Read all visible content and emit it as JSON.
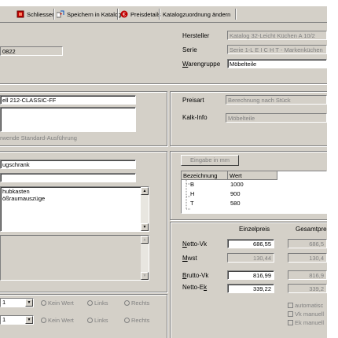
{
  "toolbar": {
    "close_label": "Schliessen",
    "save_catalog_label": "Speichern in Katalog",
    "price_details_label": "Preisdetails",
    "catalog_assign_label": "Katalogzuordnung ändern"
  },
  "header": {
    "article_no": "0822",
    "hersteller_label": "Hersteller",
    "hersteller_value": "Katalog 32-Leicht Küchen A 10/2",
    "serie_label": "Serie",
    "serie_value": "Serie 1-L E I C H T - Markenküchen",
    "warengruppe_label": "Warengruppe",
    "warengruppe_value": "Möbelteile"
  },
  "model": {
    "model_value": "ell 212-CLASSIC-FF",
    "standard_label": "rwende Standard-Ausführung"
  },
  "preis": {
    "preisart_label": "Preisart",
    "preisart_value": "Berechnung nach Stück",
    "kalk_label": "Kalk-Info",
    "kalk_value": "Möbelteile"
  },
  "article": {
    "name_value": "ugschrank",
    "desc_lines": [
      "hubkasten",
      "ößraumauszüge"
    ]
  },
  "dimensions": {
    "input_button": "Eingabe in mm",
    "columns": [
      "Bezeichnung",
      "Wert"
    ],
    "rows": [
      {
        "name": "B",
        "value": "1000"
      },
      {
        "name": "H",
        "value": "900"
      },
      {
        "name": "T",
        "value": "580"
      }
    ]
  },
  "prices": {
    "col_unit": "Einzelpreis",
    "col_total": "Gesamtpre",
    "rows": [
      {
        "label": "Netto-Vk",
        "unit": "686,55",
        "total": "686,5"
      },
      {
        "label": "Mwst",
        "unit": "130,44",
        "total": "130,4"
      },
      {
        "label": "Brutto-Vk",
        "unit": "816,99",
        "total": "816,9"
      },
      {
        "label": "Netto-Ek",
        "unit": "339,22",
        "total": "339,2"
      }
    ],
    "checks": [
      "automatisc",
      "Vk manuell",
      "Ek manuell"
    ]
  },
  "options": {
    "rows": [
      {
        "combo": "1",
        "r1": "Kein Wert",
        "r2": "Links",
        "r3": "Rechts"
      },
      {
        "combo": "1",
        "r1": "Kein Wert",
        "r2": "Links",
        "r3": "Rechts"
      }
    ]
  },
  "colors": {
    "face": "#d4d0c8",
    "shadow": "#808080",
    "red": "#cc0000"
  }
}
